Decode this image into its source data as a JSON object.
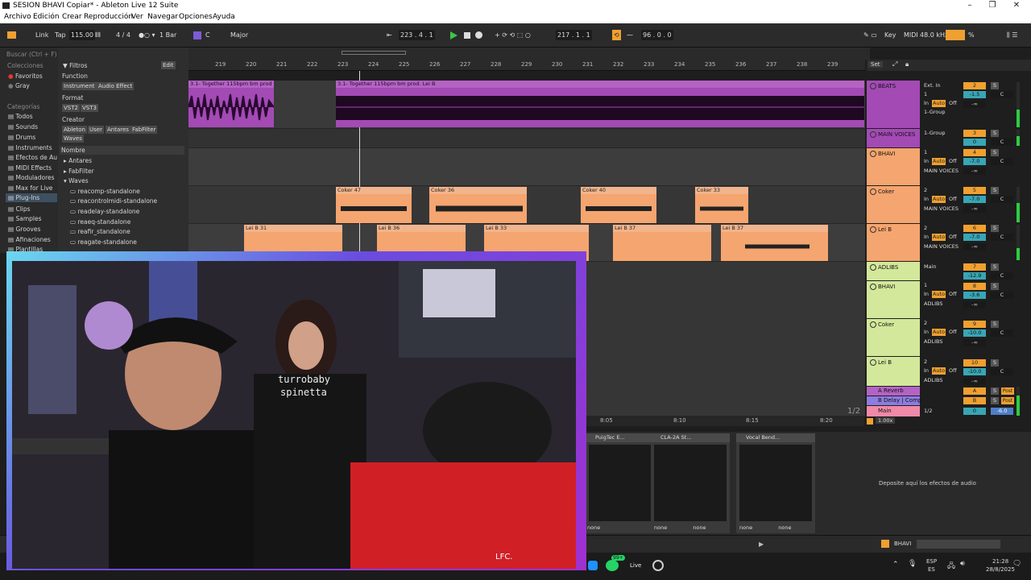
{
  "window": {
    "title": "SESION BHAVI Copiar* - Ableton Live 12 Suite"
  },
  "menu": [
    "Archivo",
    "Edición",
    "Crear",
    "Reproducción",
    "Ver",
    "Navegar",
    "Opciones",
    "Ayuda"
  ],
  "control_bar": {
    "link": "Link",
    "tap": "Tap",
    "tempo": "115.00",
    "signature": "4 / 4",
    "quantize": "1 Bar",
    "key": "C",
    "scale": "Major",
    "position": "223 . 4 . 1",
    "loop_start": "217 . 1 . 1",
    "loop_length": "96 . 0 . 0",
    "key_btn": "Key",
    "midi": "MIDI",
    "sample_rate": "48.0 kHz",
    "cpu": "%"
  },
  "browser": {
    "search_placeholder": "Buscar (Ctrl + F)",
    "collections_header": "Colecciones",
    "collections": [
      "Favoritos",
      "Gray"
    ],
    "categories_header": "Categorías",
    "categories": [
      "Todos",
      "Sounds",
      "Drums",
      "Instruments",
      "Efectos de Au",
      "MIDI Effects",
      "Moduladores",
      "Max for Live",
      "Plug-Ins",
      "Clips",
      "Samples",
      "Grooves",
      "Afinaciones",
      "Plantillas"
    ],
    "filters_label": "Filtros",
    "edit_label": "Edit",
    "function_label": "Function",
    "function_tags": [
      "Instrument",
      "Audio Effect"
    ],
    "format_label": "Format",
    "format_tags": [
      "VST2",
      "VST3"
    ],
    "creator_label": "Creator",
    "creator_tags": [
      "Ableton",
      "User",
      "Antares",
      "FabFilter",
      "Waves"
    ],
    "name_header": "Nombre",
    "folders": [
      "Antares",
      "FabFilter",
      "Waves"
    ],
    "plugins": [
      "reacomp-standalone",
      "reacontrolmidi-standalone",
      "readelay-standalone",
      "reaeq-standalone",
      "reafir_standalone",
      "reagate-standalone"
    ]
  },
  "ruler": [
    "219",
    "220",
    "221",
    "222",
    "223",
    "224",
    "225",
    "226",
    "227",
    "228",
    "229",
    "230",
    "231",
    "232",
    "233",
    "234",
    "235",
    "236",
    "237",
    "238",
    "239"
  ],
  "clips": {
    "beats_a": "3.1- Together 115bpm bm prod",
    "beats_b": "3.1- Together 115bpm bm prod. Lei B",
    "coker": [
      "Coker 47",
      "Coker 36",
      "Coker 40",
      "Coker 33"
    ],
    "leib": [
      "Lei B 31",
      "Lei B 36",
      "Lei B 33",
      "Lei B 37",
      "Lei B 37"
    ]
  },
  "tracks": [
    {
      "name": "BEATS",
      "color": "#a34ab5",
      "in": "Ext. In",
      "ch": "1",
      "group": "1-Group",
      "num": "2",
      "vol": "-1.5"
    },
    {
      "name": "MAIN VOICES",
      "color": "#a34ab5",
      "in": "1-Group",
      "num": "3",
      "vol": "0"
    },
    {
      "name": "BHAVI",
      "color": "#f5a56f",
      "in": "1",
      "out": "MAIN VOICES",
      "num": "4",
      "vol": "-7.0"
    },
    {
      "name": "Coker",
      "color": "#f5a56f",
      "in": "2",
      "out": "MAIN VOICES",
      "num": "5",
      "vol": "-7.0"
    },
    {
      "name": "Lei B",
      "color": "#f5a56f",
      "in": "2",
      "out": "MAIN VOICES",
      "num": "6",
      "vol": "-7.0"
    },
    {
      "name": "ADLIBS",
      "color": "#d3e89a",
      "in": "Main",
      "num": "7",
      "vol": "-12.9"
    },
    {
      "name": "BHAVI",
      "color": "#d3e89a",
      "in": "1",
      "out": "ADLIBS",
      "num": "8",
      "vol": "-3.6"
    },
    {
      "name": "Coker",
      "color": "#d3e89a",
      "in": "2",
      "out": "ADLIBS",
      "num": "9",
      "vol": "-10.0"
    },
    {
      "name": "Lei B",
      "color": "#d3e89a",
      "in": "2",
      "out": "ADLIBS",
      "num": "10",
      "vol": "-10.0"
    }
  ],
  "returns": [
    {
      "name": "A Reverb",
      "letter": "A",
      "post": "Post"
    },
    {
      "name": "B Delay | Comp",
      "letter": "B",
      "post": "Post"
    },
    {
      "name": "Main",
      "out": "1/2",
      "num": "0",
      "vol": "-6.0"
    }
  ],
  "mixer_labels": {
    "set": "Set",
    "in": "In",
    "auto": "Auto",
    "off": "Off",
    "s": "S",
    "c": "C",
    "inf": "-∞",
    "page": "1/2",
    "zoom": "1.00x"
  },
  "timeline2": [
    "8:05",
    "8:10",
    "8:15",
    "8:20"
  ],
  "devices": [
    "PuigTec E...",
    "CLA-2A St...",
    "Vocal Bend..."
  ],
  "device_none": "none",
  "drop_text": "Deposite aquí los efectos de audio",
  "status": {
    "track": "BHAVI"
  },
  "taskbar": {
    "lang1": "ESP",
    "lang2": "ES",
    "time": "21:28",
    "date": "28/8/2025",
    "badge": "99+",
    "live": "Live"
  },
  "webcam": {
    "shirt_text_1": "turrobaby",
    "shirt_text_2": "spinetta",
    "shirt_text_3": "LFC."
  }
}
